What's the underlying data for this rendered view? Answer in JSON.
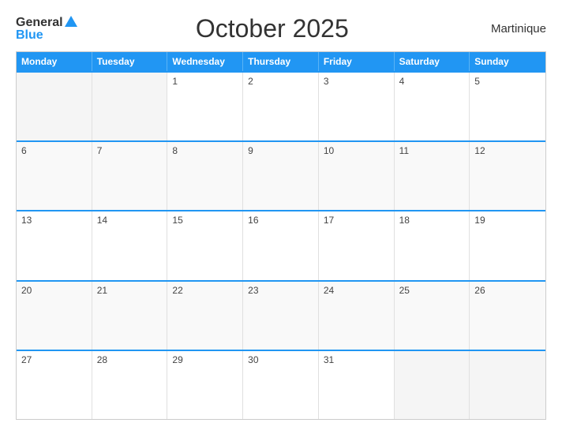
{
  "header": {
    "logo_general": "General",
    "logo_blue": "Blue",
    "title": "October 2025",
    "region": "Martinique"
  },
  "calendar": {
    "days_of_week": [
      "Monday",
      "Tuesday",
      "Wednesday",
      "Thursday",
      "Friday",
      "Saturday",
      "Sunday"
    ],
    "weeks": [
      [
        {
          "day": "",
          "empty": true
        },
        {
          "day": "",
          "empty": true
        },
        {
          "day": "1",
          "empty": false
        },
        {
          "day": "2",
          "empty": false
        },
        {
          "day": "3",
          "empty": false
        },
        {
          "day": "4",
          "empty": false
        },
        {
          "day": "5",
          "empty": false
        }
      ],
      [
        {
          "day": "6",
          "empty": false
        },
        {
          "day": "7",
          "empty": false
        },
        {
          "day": "8",
          "empty": false
        },
        {
          "day": "9",
          "empty": false
        },
        {
          "day": "10",
          "empty": false
        },
        {
          "day": "11",
          "empty": false
        },
        {
          "day": "12",
          "empty": false
        }
      ],
      [
        {
          "day": "13",
          "empty": false
        },
        {
          "day": "14",
          "empty": false
        },
        {
          "day": "15",
          "empty": false
        },
        {
          "day": "16",
          "empty": false
        },
        {
          "day": "17",
          "empty": false
        },
        {
          "day": "18",
          "empty": false
        },
        {
          "day": "19",
          "empty": false
        }
      ],
      [
        {
          "day": "20",
          "empty": false
        },
        {
          "day": "21",
          "empty": false
        },
        {
          "day": "22",
          "empty": false
        },
        {
          "day": "23",
          "empty": false
        },
        {
          "day": "24",
          "empty": false
        },
        {
          "day": "25",
          "empty": false
        },
        {
          "day": "26",
          "empty": false
        }
      ],
      [
        {
          "day": "27",
          "empty": false
        },
        {
          "day": "28",
          "empty": false
        },
        {
          "day": "29",
          "empty": false
        },
        {
          "day": "30",
          "empty": false
        },
        {
          "day": "31",
          "empty": false
        },
        {
          "day": "",
          "empty": true
        },
        {
          "day": "",
          "empty": true
        }
      ]
    ]
  }
}
